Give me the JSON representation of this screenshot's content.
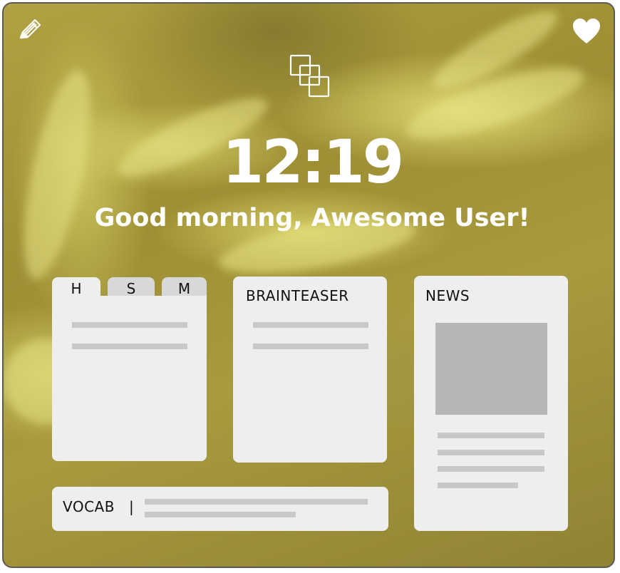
{
  "header": {
    "edit_icon": "pencil-icon",
    "favorite_icon": "heart-icon",
    "logo_icon": "stacked-squares-icon"
  },
  "clock": {
    "time": "12:19",
    "greeting": "Good morning, Awesome User!"
  },
  "widgets": {
    "tabs": [
      {
        "label": "H",
        "active": true
      },
      {
        "label": "S",
        "active": false
      },
      {
        "label": "M",
        "active": false
      }
    ],
    "brainteaser": {
      "title": "BRAINTEASER"
    },
    "news": {
      "title": "NEWS"
    },
    "vocab": {
      "label": "VOCAB",
      "separator": "|"
    }
  },
  "colors": {
    "card_background": "#eeeeee",
    "placeholder_line": "#c8c8c8",
    "news_image_placeholder": "#b6b6b6",
    "text_on_background": "#ffffff",
    "frame_border": "#5c5a55"
  }
}
